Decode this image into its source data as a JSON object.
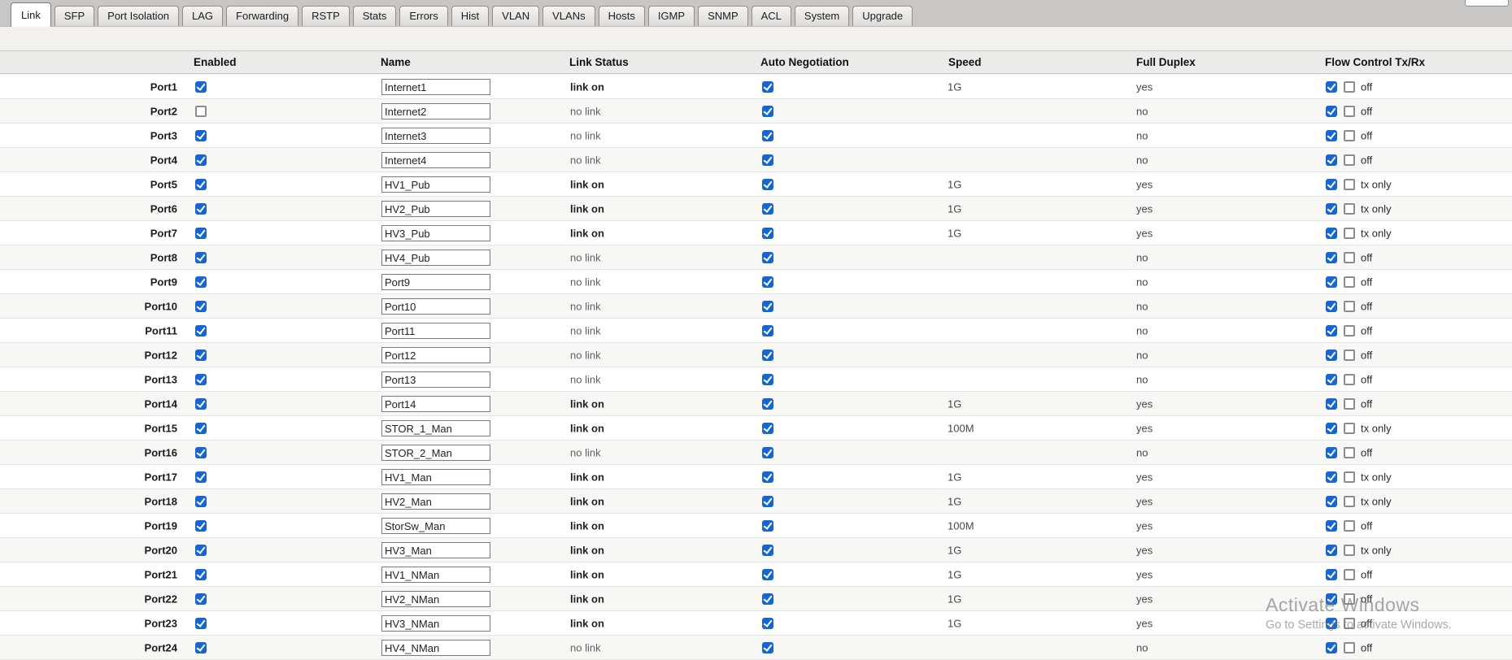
{
  "tabs": {
    "items": [
      {
        "label": "Link",
        "active": true
      },
      {
        "label": "SFP",
        "active": false
      },
      {
        "label": "Port Isolation",
        "active": false
      },
      {
        "label": "LAG",
        "active": false
      },
      {
        "label": "Forwarding",
        "active": false
      },
      {
        "label": "RSTP",
        "active": false
      },
      {
        "label": "Stats",
        "active": false
      },
      {
        "label": "Errors",
        "active": false
      },
      {
        "label": "Hist",
        "active": false
      },
      {
        "label": "VLAN",
        "active": false
      },
      {
        "label": "VLANs",
        "active": false
      },
      {
        "label": "Hosts",
        "active": false
      },
      {
        "label": "IGMP",
        "active": false
      },
      {
        "label": "SNMP",
        "active": false
      },
      {
        "label": "ACL",
        "active": false
      },
      {
        "label": "System",
        "active": false
      },
      {
        "label": "Upgrade",
        "active": false
      }
    ]
  },
  "table": {
    "headers": [
      "Enabled",
      "Name",
      "Link Status",
      "Auto Negotiation",
      "Speed",
      "Full Duplex",
      "Flow Control Tx/Rx"
    ],
    "rows": [
      {
        "port": "Port1",
        "enabled": true,
        "name": "Internet1",
        "link_status": "link on",
        "auto_negotiation": true,
        "speed": "1G",
        "full_duplex": "yes",
        "flow_tx": true,
        "flow_rx": false,
        "flow_label": "off"
      },
      {
        "port": "Port2",
        "enabled": false,
        "name": "Internet2",
        "link_status": "no link",
        "auto_negotiation": true,
        "speed": "",
        "full_duplex": "no",
        "flow_tx": true,
        "flow_rx": false,
        "flow_label": "off"
      },
      {
        "port": "Port3",
        "enabled": true,
        "name": "Internet3",
        "link_status": "no link",
        "auto_negotiation": true,
        "speed": "",
        "full_duplex": "no",
        "flow_tx": true,
        "flow_rx": false,
        "flow_label": "off"
      },
      {
        "port": "Port4",
        "enabled": true,
        "name": "Internet4",
        "link_status": "no link",
        "auto_negotiation": true,
        "speed": "",
        "full_duplex": "no",
        "flow_tx": true,
        "flow_rx": false,
        "flow_label": "off"
      },
      {
        "port": "Port5",
        "enabled": true,
        "name": "HV1_Pub",
        "link_status": "link on",
        "auto_negotiation": true,
        "speed": "1G",
        "full_duplex": "yes",
        "flow_tx": true,
        "flow_rx": false,
        "flow_label": "tx only"
      },
      {
        "port": "Port6",
        "enabled": true,
        "name": "HV2_Pub",
        "link_status": "link on",
        "auto_negotiation": true,
        "speed": "1G",
        "full_duplex": "yes",
        "flow_tx": true,
        "flow_rx": false,
        "flow_label": "tx only"
      },
      {
        "port": "Port7",
        "enabled": true,
        "name": "HV3_Pub",
        "link_status": "link on",
        "auto_negotiation": true,
        "speed": "1G",
        "full_duplex": "yes",
        "flow_tx": true,
        "flow_rx": false,
        "flow_label": "tx only"
      },
      {
        "port": "Port8",
        "enabled": true,
        "name": "HV4_Pub",
        "link_status": "no link",
        "auto_negotiation": true,
        "speed": "",
        "full_duplex": "no",
        "flow_tx": true,
        "flow_rx": false,
        "flow_label": "off"
      },
      {
        "port": "Port9",
        "enabled": true,
        "name": "Port9",
        "link_status": "no link",
        "auto_negotiation": true,
        "speed": "",
        "full_duplex": "no",
        "flow_tx": true,
        "flow_rx": false,
        "flow_label": "off"
      },
      {
        "port": "Port10",
        "enabled": true,
        "name": "Port10",
        "link_status": "no link",
        "auto_negotiation": true,
        "speed": "",
        "full_duplex": "no",
        "flow_tx": true,
        "flow_rx": false,
        "flow_label": "off"
      },
      {
        "port": "Port11",
        "enabled": true,
        "name": "Port11",
        "link_status": "no link",
        "auto_negotiation": true,
        "speed": "",
        "full_duplex": "no",
        "flow_tx": true,
        "flow_rx": false,
        "flow_label": "off"
      },
      {
        "port": "Port12",
        "enabled": true,
        "name": "Port12",
        "link_status": "no link",
        "auto_negotiation": true,
        "speed": "",
        "full_duplex": "no",
        "flow_tx": true,
        "flow_rx": false,
        "flow_label": "off"
      },
      {
        "port": "Port13",
        "enabled": true,
        "name": "Port13",
        "link_status": "no link",
        "auto_negotiation": true,
        "speed": "",
        "full_duplex": "no",
        "flow_tx": true,
        "flow_rx": false,
        "flow_label": "off"
      },
      {
        "port": "Port14",
        "enabled": true,
        "name": "Port14",
        "link_status": "link on",
        "auto_negotiation": true,
        "speed": "1G",
        "full_duplex": "yes",
        "flow_tx": true,
        "flow_rx": false,
        "flow_label": "off"
      },
      {
        "port": "Port15",
        "enabled": true,
        "name": "STOR_1_Man",
        "link_status": "link on",
        "auto_negotiation": true,
        "speed": "100M",
        "full_duplex": "yes",
        "flow_tx": true,
        "flow_rx": false,
        "flow_label": "tx only"
      },
      {
        "port": "Port16",
        "enabled": true,
        "name": "STOR_2_Man",
        "link_status": "no link",
        "auto_negotiation": true,
        "speed": "",
        "full_duplex": "no",
        "flow_tx": true,
        "flow_rx": false,
        "flow_label": "off"
      },
      {
        "port": "Port17",
        "enabled": true,
        "name": "HV1_Man",
        "link_status": "link on",
        "auto_negotiation": true,
        "speed": "1G",
        "full_duplex": "yes",
        "flow_tx": true,
        "flow_rx": false,
        "flow_label": "tx only"
      },
      {
        "port": "Port18",
        "enabled": true,
        "name": "HV2_Man",
        "link_status": "link on",
        "auto_negotiation": true,
        "speed": "1G",
        "full_duplex": "yes",
        "flow_tx": true,
        "flow_rx": false,
        "flow_label": "tx only"
      },
      {
        "port": "Port19",
        "enabled": true,
        "name": "StorSw_Man",
        "link_status": "link on",
        "auto_negotiation": true,
        "speed": "100M",
        "full_duplex": "yes",
        "flow_tx": true,
        "flow_rx": false,
        "flow_label": "off"
      },
      {
        "port": "Port20",
        "enabled": true,
        "name": "HV3_Man",
        "link_status": "link on",
        "auto_negotiation": true,
        "speed": "1G",
        "full_duplex": "yes",
        "flow_tx": true,
        "flow_rx": false,
        "flow_label": "tx only"
      },
      {
        "port": "Port21",
        "enabled": true,
        "name": "HV1_NMan",
        "link_status": "link on",
        "auto_negotiation": true,
        "speed": "1G",
        "full_duplex": "yes",
        "flow_tx": true,
        "flow_rx": false,
        "flow_label": "off"
      },
      {
        "port": "Port22",
        "enabled": true,
        "name": "HV2_NMan",
        "link_status": "link on",
        "auto_negotiation": true,
        "speed": "1G",
        "full_duplex": "yes",
        "flow_tx": true,
        "flow_rx": false,
        "flow_label": "off"
      },
      {
        "port": "Port23",
        "enabled": true,
        "name": "HV3_NMan",
        "link_status": "link on",
        "auto_negotiation": true,
        "speed": "1G",
        "full_duplex": "yes",
        "flow_tx": true,
        "flow_rx": false,
        "flow_label": "off"
      },
      {
        "port": "Port24",
        "enabled": true,
        "name": "HV4_NMan",
        "link_status": "no link",
        "auto_negotiation": true,
        "speed": "",
        "full_duplex": "no",
        "flow_tx": true,
        "flow_rx": false,
        "flow_label": "off"
      }
    ]
  },
  "watermark": {
    "line1": "Activate Windows",
    "line2": "Go to Settings to activate Windows."
  },
  "colors": {
    "checkbox_checked": "#1565d2",
    "tab_bar_bg": "#c9c7c5",
    "header_row_bg": "#ebebea",
    "alt_row_bg": "#f7f7f6"
  }
}
